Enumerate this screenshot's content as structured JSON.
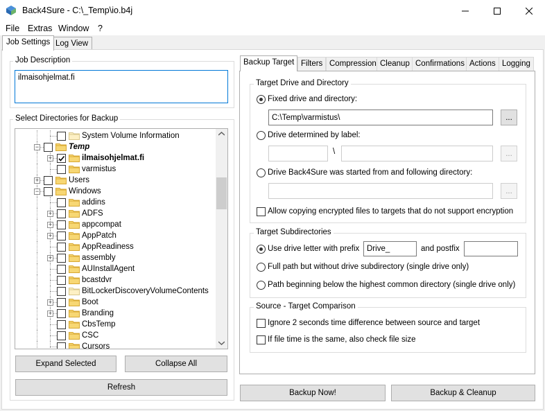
{
  "window": {
    "title": "Back4Sure - C:\\_Temp\\io.b4j",
    "minimize": "—",
    "maximize": "☐",
    "close": "✕"
  },
  "menu": {
    "items": [
      {
        "name": "file",
        "label": "File"
      },
      {
        "name": "extras",
        "label": "Extras"
      },
      {
        "name": "window",
        "label": "Window"
      },
      {
        "name": "help",
        "label": "?"
      }
    ]
  },
  "top_tabs": [
    {
      "label": "Job Settings",
      "active": true
    },
    {
      "label": "Log View",
      "active": false
    }
  ],
  "job_description": {
    "title": "Job Description",
    "value": "ilmaisohjelmat.fi"
  },
  "directories": {
    "title": "Select Directories for Backup",
    "items": [
      {
        "label": "System Volume Information",
        "checked": false,
        "expander": "",
        "style": "normal",
        "folder": "pale"
      },
      {
        "label": "Temp",
        "checked": false,
        "expander": "−",
        "style": "bold-italic",
        "folder": "yellow"
      },
      {
        "label": "ilmaisohjelmat.fi",
        "checked": true,
        "expander": "+",
        "style": "bold",
        "folder": "yellow"
      },
      {
        "label": "varmistus",
        "checked": false,
        "expander": "",
        "style": "normal",
        "folder": "yellow"
      },
      {
        "label": "Users",
        "checked": false,
        "expander": "+",
        "style": "normal",
        "folder": "yellow"
      },
      {
        "label": "Windows",
        "checked": false,
        "expander": "−",
        "style": "normal",
        "folder": "yellow"
      },
      {
        "label": "addins",
        "checked": false,
        "expander": "",
        "style": "normal",
        "folder": "yellow"
      },
      {
        "label": "ADFS",
        "checked": false,
        "expander": "+",
        "style": "normal",
        "folder": "yellow"
      },
      {
        "label": "appcompat",
        "checked": false,
        "expander": "+",
        "style": "normal",
        "folder": "yellow"
      },
      {
        "label": "AppPatch",
        "checked": false,
        "expander": "+",
        "style": "normal",
        "folder": "yellow"
      },
      {
        "label": "AppReadiness",
        "checked": false,
        "expander": "",
        "style": "normal",
        "folder": "yellow"
      },
      {
        "label": "assembly",
        "checked": false,
        "expander": "+",
        "style": "normal",
        "folder": "yellow"
      },
      {
        "label": "AUInstallAgent",
        "checked": false,
        "expander": "",
        "style": "normal",
        "folder": "yellow"
      },
      {
        "label": "bcastdvr",
        "checked": false,
        "expander": "",
        "style": "normal",
        "folder": "yellow"
      },
      {
        "label": "BitLockerDiscoveryVolumeContents",
        "checked": false,
        "expander": "",
        "style": "normal",
        "folder": "pale"
      },
      {
        "label": "Boot",
        "checked": false,
        "expander": "+",
        "style": "normal",
        "folder": "yellow"
      },
      {
        "label": "Branding",
        "checked": false,
        "expander": "+",
        "style": "normal",
        "folder": "yellow"
      },
      {
        "label": "CbsTemp",
        "checked": false,
        "expander": "",
        "style": "normal",
        "folder": "yellow"
      },
      {
        "label": "CSC",
        "checked": false,
        "expander": "",
        "style": "normal",
        "folder": "yellow"
      },
      {
        "label": "Cursors",
        "checked": false,
        "expander": "",
        "style": "normal",
        "folder": "yellow"
      }
    ],
    "expand_button": "Expand Selected",
    "collapse_button": "Collapse All",
    "refresh_button": "Refresh"
  },
  "right_tabs": [
    {
      "label": "Backup Target",
      "active": true
    },
    {
      "label": "Filters",
      "active": false
    },
    {
      "label": "Compression",
      "active": false
    },
    {
      "label": "Cleanup",
      "active": false
    },
    {
      "label": "Confirmations",
      "active": false
    },
    {
      "label": "Actions",
      "active": false
    },
    {
      "label": "Logging",
      "active": false
    }
  ],
  "target": {
    "group_title": "Target Drive and Directory",
    "fixed_label": "Fixed drive and directory:",
    "fixed_value": "C:\\Temp\\varmistus\\",
    "browse": "...",
    "label_option": "Drive determined by label:",
    "separator": "\\",
    "started_option": "Drive Back4Sure was started from and following directory:",
    "allow_encrypted": "Allow copying encrypted files to targets that do not support encryption"
  },
  "subdirs": {
    "group_title": "Target Subdirectories",
    "option1_label": "Use drive letter with prefix",
    "prefix_value": "Drive_",
    "postfix_label": "and postfix",
    "postfix_value": "",
    "option2_label": "Full path but without drive subdirectory (single drive only)",
    "option3_label": "Path beginning below the highest common directory (single drive only)"
  },
  "comparison": {
    "group_title": "Source - Target Comparison",
    "ignore_time": "Ignore 2 seconds time difference between source and target",
    "check_size": "If file time is the same, also check file size"
  },
  "actions": {
    "backup_now": "Backup Now!",
    "backup_cleanup": "Backup & Cleanup"
  }
}
